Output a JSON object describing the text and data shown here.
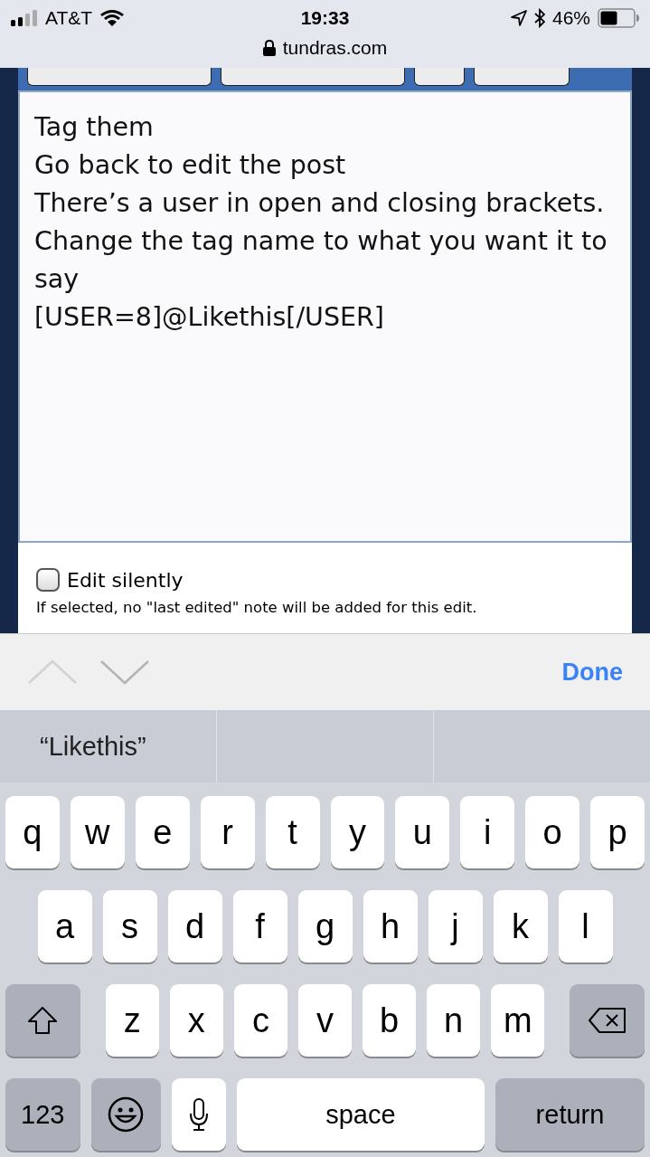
{
  "status_bar": {
    "carrier": "AT&T",
    "time": "19:33",
    "battery": "46%"
  },
  "address_bar": {
    "url": "tundras.com"
  },
  "editor": {
    "lines": [
      "Tag them",
      "Go back to edit the post",
      "There’s a user in open and closing brackets.",
      "Change the tag name to what you want it to say",
      "[USER=8]@Likethis[/USER]"
    ]
  },
  "edit_silently": {
    "label": "Edit silently",
    "checked": false,
    "hint": "If selected, no \"last edited\" note will be added for this edit."
  },
  "accessory_bar": {
    "previous_disabled": true,
    "next_disabled": false,
    "done": "Done"
  },
  "suggestions": [
    "“Likethis”"
  ],
  "keyboard": {
    "rows": [
      {
        "keys": [
          {
            "kind": "letter",
            "label": "q"
          },
          {
            "kind": "letter",
            "label": "w"
          },
          {
            "kind": "letter",
            "label": "e"
          },
          {
            "kind": "letter",
            "label": "r"
          },
          {
            "kind": "letter",
            "label": "t"
          },
          {
            "kind": "letter",
            "label": "y"
          },
          {
            "kind": "letter",
            "label": "u"
          },
          {
            "kind": "letter",
            "label": "i"
          },
          {
            "kind": "letter",
            "label": "o"
          },
          {
            "kind": "letter",
            "label": "p"
          }
        ]
      },
      {
        "keys": [
          {
            "kind": "letter",
            "label": "a"
          },
          {
            "kind": "letter",
            "label": "s"
          },
          {
            "kind": "letter",
            "label": "d"
          },
          {
            "kind": "letter",
            "label": "f"
          },
          {
            "kind": "letter",
            "label": "g"
          },
          {
            "kind": "letter",
            "label": "h"
          },
          {
            "kind": "letter",
            "label": "j"
          },
          {
            "kind": "letter",
            "label": "k"
          },
          {
            "kind": "letter",
            "label": "l"
          }
        ]
      },
      {
        "keys": [
          {
            "kind": "shift"
          },
          {
            "kind": "letter",
            "label": "z"
          },
          {
            "kind": "letter",
            "label": "x"
          },
          {
            "kind": "letter",
            "label": "c"
          },
          {
            "kind": "letter",
            "label": "v"
          },
          {
            "kind": "letter",
            "label": "b"
          },
          {
            "kind": "letter",
            "label": "n"
          },
          {
            "kind": "letter",
            "label": "m"
          },
          {
            "kind": "delete"
          }
        ]
      },
      {
        "keys": [
          {
            "kind": "numbers",
            "label": "123"
          },
          {
            "kind": "emoji"
          },
          {
            "kind": "mic"
          },
          {
            "kind": "space",
            "label": "space"
          },
          {
            "kind": "return",
            "label": "return"
          }
        ]
      }
    ]
  }
}
